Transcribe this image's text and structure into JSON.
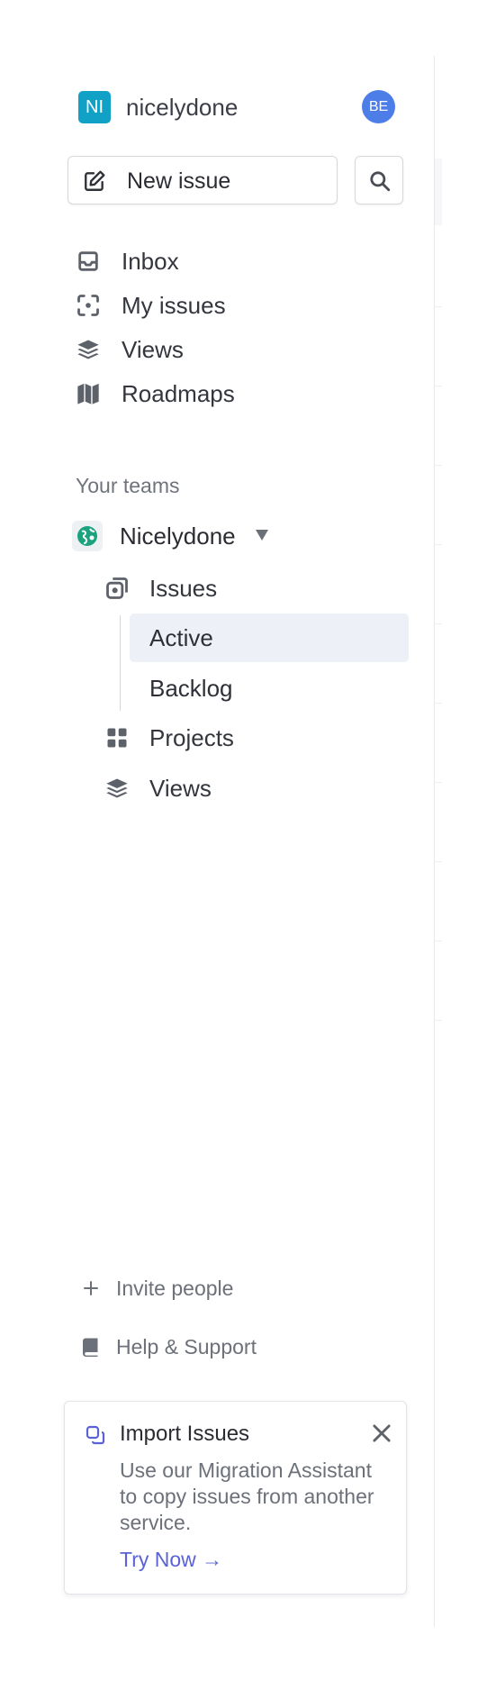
{
  "workspace": {
    "logo_initials": "NI",
    "name": "nicelydone",
    "user_initials": "BE"
  },
  "actions": {
    "new_issue_label": "New issue"
  },
  "nav": {
    "items": [
      {
        "label": "Inbox",
        "icon": "inbox-icon"
      },
      {
        "label": "My issues",
        "icon": "my-issues-icon"
      },
      {
        "label": "Views",
        "icon": "views-icon"
      },
      {
        "label": "Roadmaps",
        "icon": "map-icon"
      }
    ]
  },
  "teams": {
    "section_label": "Your teams",
    "team": {
      "name": "Nicelydone",
      "items": [
        {
          "label": "Issues",
          "icon": "issues-icon"
        },
        {
          "label": "Projects",
          "icon": "projects-icon"
        },
        {
          "label": "Views",
          "icon": "views-icon"
        }
      ],
      "issue_views": [
        {
          "label": "Active",
          "selected": true
        },
        {
          "label": "Backlog",
          "selected": false
        }
      ]
    }
  },
  "footer": {
    "invite_label": "Invite people",
    "help_label": "Help & Support"
  },
  "import_card": {
    "title": "Import Issues",
    "description": "Use our Migration Assistant to copy issues from another service.",
    "cta_label": "Try Now →"
  },
  "colors": {
    "workspace_logo": "#12a1c6",
    "avatar": "#4d7ee8",
    "selected_bg": "#eef0f7",
    "link": "#5a62d6",
    "team_icon": "#1aa37e"
  }
}
